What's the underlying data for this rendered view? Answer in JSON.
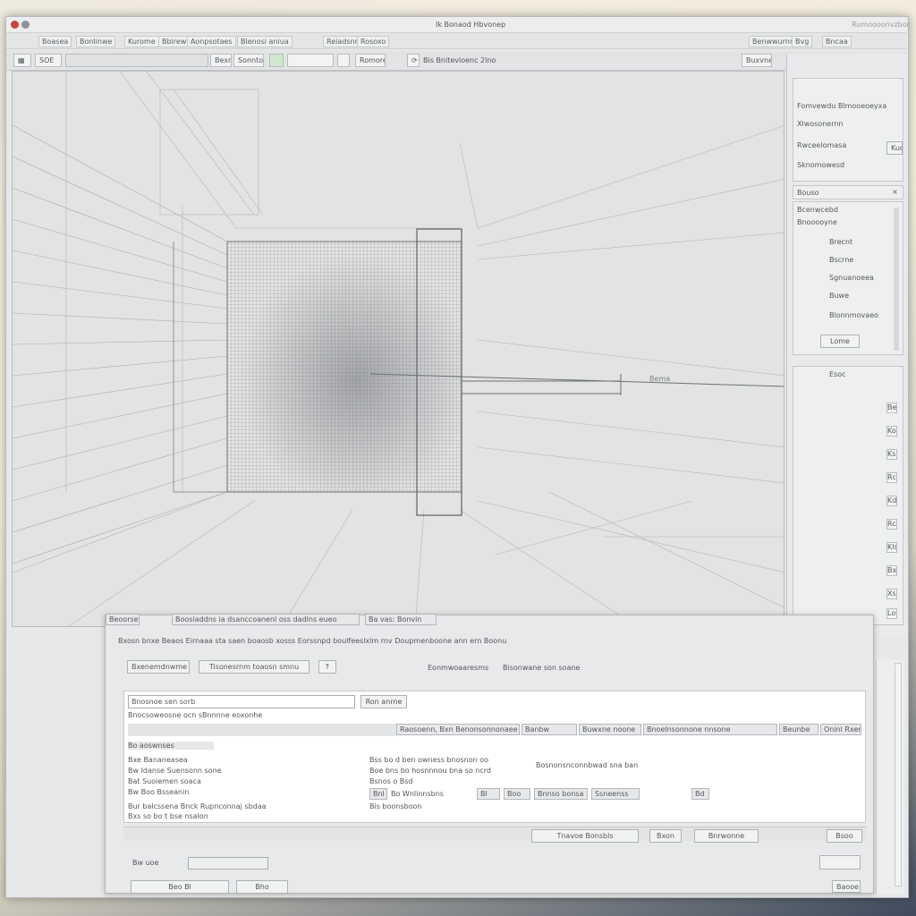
{
  "window": {
    "title": "Ik Bonaod Hbvonep",
    "top_right": "Rumoooonvzbor"
  },
  "menubar": {
    "items": [
      "Boasea",
      "Bonlinwe",
      "Kurome",
      "Bbirew",
      "Aonpsotaes",
      "Blenosi aniua",
      "Reiadsnne",
      "Rosoxo"
    ],
    "right_items": [
      "Benwwurnns",
      "Bvg",
      "Bncaa"
    ]
  },
  "toolbar": {
    "left_field": "SOE",
    "btn1": "Bexnn",
    "btn2": "Sonntonit",
    "zoom": "Romore",
    "status": "Bis Bnitevloenc 2lno",
    "right_label": "Buxvnew"
  },
  "right_panel": {
    "section1_rows": [
      "Fomvewdu Blmooeoeyxa",
      "Xlwosonernn",
      "Rwceelomasa",
      "Sknomowesd"
    ],
    "side_tag": "Kuo",
    "section2_title": "Bouso",
    "section2_rows": [
      "Bcenwcebd",
      "Bnooooyne",
      "Brecnt",
      "Bscrne",
      "Sgnuanoeea",
      "Buwe",
      "Blonnmovaeo"
    ],
    "section2_button": "Lome",
    "section3_title": "Esoc",
    "section3_icons": [
      "Be",
      "Kon",
      "Ks",
      "Rc",
      "Kds",
      "Rcs",
      "Kls",
      "Bx",
      "Xs",
      "Lou"
    ]
  },
  "viewport": {
    "dim_label": "Bema"
  },
  "dialog": {
    "tabs": [
      "Beoorse",
      "Boosiaddns ia dsanccoanenl oss dadlns eueo",
      "Ba vas: Bonvin"
    ],
    "path_bar": "Bxosn bnxe Beaos Eirnaaa sta saen boaosb xosss Eorssnpd boulfeeslxlm rnv Doupmenboone ann ern Boonu",
    "toolbar_left": "Bxenemdnwme",
    "toolbar_mid": "Tisonesrnm toaosn smnu",
    "toolbar_right1": "Eonmwoaaresms",
    "toolbar_right2": "Bisonwane son soane",
    "search_value": "Bnosnoe sen sorb",
    "search_button": "Ron anrne",
    "sub_label": "Bnocsoweosne ocn sBnnnne eoxonhe",
    "columns": [
      "Raosoenn, Bxn Benonsonnonaee",
      "Banbw",
      "Buwxne noone",
      "Bnoelnsonnone nnsone",
      "Beunbe",
      "Oninl Rxen"
    ],
    "left_rows": [
      "Bo aoswnses",
      "Bxe  Bananeasea",
      "Bw  Idanse Suensonn sone",
      "Bat  Suoiemen soaca",
      "Bw  Boo   Bsseanin"
    ],
    "left_notes": [
      "Bur balcssena Bnck  Rupnconnaj sbdaa",
      "Bxs so bo t bse nsalon"
    ],
    "center_rows": [
      "Bss bo d ben owness bnosnon oo",
      "Boe bns bo hosnnnou bna so ncrd",
      "Bsnos o   Bsd"
    ],
    "center_right_note": "Bosnonsnconnbwad sna ban",
    "filter_row": [
      "Bnl",
      "Bo  Wnlinnsbns",
      "Bl",
      "Boo",
      "Bnnso bonsa",
      "Ssneenss",
      "Bd"
    ],
    "center_note": "Bis boonsboon",
    "bottom_button1": "Tnavoe Bonsbls",
    "bottom_button2": "Bxon",
    "bottom_button3": "Bnrwonne",
    "bottom_button4": "Bsoo",
    "field_label": "Bw  uoe",
    "btn_ok": "Beo  Bl",
    "btn_mid": "Bho",
    "btn_cancel": "Baooe"
  }
}
